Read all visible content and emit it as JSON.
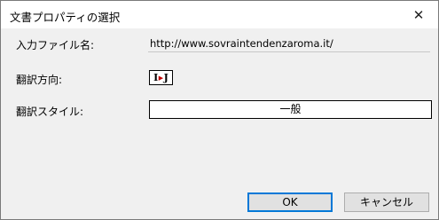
{
  "window": {
    "title": "文書プロパティの選択",
    "close_glyph": "✕"
  },
  "fields": {
    "input_file_label": "入力ファイル名:",
    "input_file_value": "http://www.sovraintendenzaroma.it/",
    "direction_label": "翻訳方向:",
    "direction": {
      "from": "I",
      "to": "J",
      "arrow_glyph": "▶"
    },
    "style_label": "翻訳スタイル:",
    "style_value": "一般"
  },
  "buttons": {
    "ok": "OK",
    "cancel": "キャンセル"
  }
}
